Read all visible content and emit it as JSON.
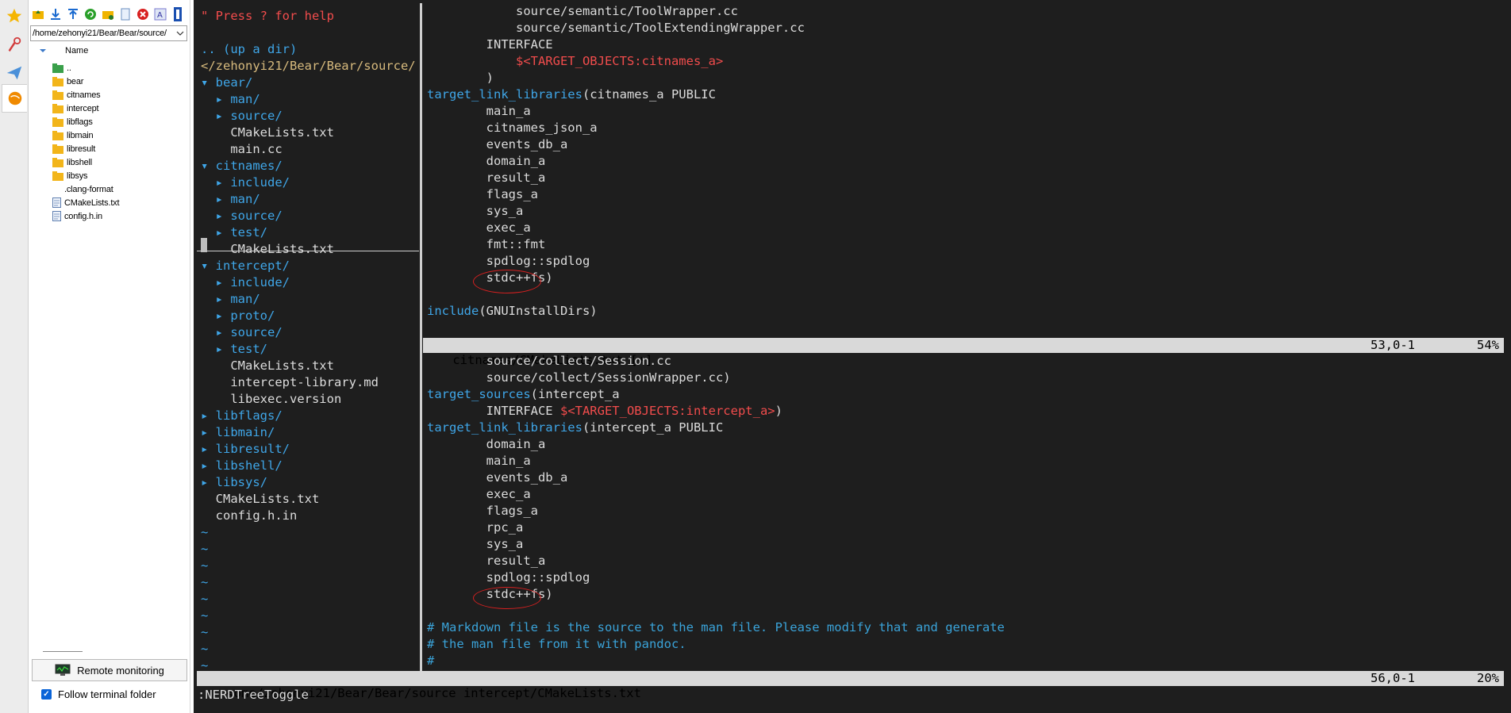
{
  "tab_strip": {
    "tabs": [
      {
        "name": "favorites-tab-icon",
        "color": "#f5b500"
      },
      {
        "name": "tools-tab-icon",
        "color": "#d23c3c"
      },
      {
        "name": "sftp-tab-icon",
        "color": "#4a90d9"
      },
      {
        "name": "macros-tab-icon",
        "color": "#f08a00"
      }
    ]
  },
  "sftp": {
    "path": "/home/zehonyi21/Bear/Bear/source/",
    "column_name": "Name",
    "files": [
      {
        "name": "..",
        "kind": "parent"
      },
      {
        "name": "bear",
        "kind": "folder"
      },
      {
        "name": "citnames",
        "kind": "folder"
      },
      {
        "name": "intercept",
        "kind": "folder"
      },
      {
        "name": "libflags",
        "kind": "folder"
      },
      {
        "name": "libmain",
        "kind": "folder"
      },
      {
        "name": "libresult",
        "kind": "folder"
      },
      {
        "name": "libshell",
        "kind": "folder"
      },
      {
        "name": "libsys",
        "kind": "folder"
      },
      {
        "name": ".clang-format",
        "kind": "blank"
      },
      {
        "name": "CMakeLists.txt",
        "kind": "file"
      },
      {
        "name": "config.h.in",
        "kind": "file"
      }
    ],
    "remote_monitoring_label": "Remote monitoring",
    "follow_terminal_label": "Follow terminal folder",
    "follow_terminal_checked": true
  },
  "tree": {
    "lines": [
      {
        "text": "\" Press ? for help",
        "color": "red"
      },
      {
        "text": "",
        "color": "white"
      },
      {
        "text": ".. (up a dir)",
        "color": "blue"
      },
      {
        "text": "</zehonyi21/Bear/Bear/source/",
        "color": "yellow"
      },
      {
        "text": "▾ bear/",
        "color": "blue"
      },
      {
        "text": "  ▸ man/",
        "color": "blue"
      },
      {
        "text": "  ▸ source/",
        "color": "blue"
      },
      {
        "text": "    CMakeLists.txt",
        "color": "white"
      },
      {
        "text": "    main.cc",
        "color": "white"
      },
      {
        "text": "▾ citnames/",
        "color": "blue"
      },
      {
        "text": "  ▸ include/",
        "color": "blue"
      },
      {
        "text": "  ▸ man/",
        "color": "blue"
      },
      {
        "text": "  ▸ source/",
        "color": "blue"
      },
      {
        "text": "  ▸ test/",
        "color": "blue"
      },
      {
        "text": "    CMakeLists.txt",
        "color": "white"
      },
      {
        "text": "▾ intercept/",
        "color": "blue"
      },
      {
        "text": "  ▸ include/",
        "color": "blue"
      },
      {
        "text": "  ▸ man/",
        "color": "blue"
      },
      {
        "text": "  ▸ proto/",
        "color": "blue"
      },
      {
        "text": "  ▸ source/",
        "color": "blue"
      },
      {
        "text": "  ▸ test/",
        "color": "blue"
      },
      {
        "text": "    CMakeLists.txt",
        "color": "white"
      },
      {
        "text": "    intercept-library.md",
        "color": "white"
      },
      {
        "text": "    libexec.version",
        "color": "white"
      },
      {
        "text": "▸ libflags/",
        "color": "blue"
      },
      {
        "text": "▸ libmain/",
        "color": "blue"
      },
      {
        "text": "▸ libresult/",
        "color": "blue"
      },
      {
        "text": "▸ libshell/",
        "color": "blue"
      },
      {
        "text": "▸ libsys/",
        "color": "blue"
      },
      {
        "text": "  CMakeLists.txt",
        "color": "white"
      },
      {
        "text": "  config.h.in",
        "color": "white"
      },
      {
        "text": "~",
        "color": "blue"
      },
      {
        "text": "~",
        "color": "blue"
      },
      {
        "text": "~",
        "color": "blue"
      },
      {
        "text": "~",
        "color": "blue"
      },
      {
        "text": "~",
        "color": "blue"
      },
      {
        "text": "~",
        "color": "blue"
      },
      {
        "text": "~",
        "color": "blue"
      },
      {
        "text": "~",
        "color": "blue"
      },
      {
        "text": "~",
        "color": "blue"
      }
    ]
  },
  "editor_top": {
    "lines": [
      [
        {
          "t": "            source/semantic/ToolWrapper.cc",
          "c": "white"
        }
      ],
      [
        {
          "t": "            source/semantic/ToolExtendingWrapper.cc",
          "c": "white"
        }
      ],
      [
        {
          "t": "        INTERFACE",
          "c": "white"
        }
      ],
      [
        {
          "t": "            ",
          "c": "white"
        },
        {
          "t": "$<TARGET_OBJECTS:citnames_a>",
          "c": "red"
        }
      ],
      [
        {
          "t": "        )",
          "c": "white"
        }
      ],
      [
        {
          "t": "target_link_libraries",
          "c": "blue"
        },
        {
          "t": "(citnames_a PUBLIC",
          "c": "white"
        }
      ],
      [
        {
          "t": "        main_a",
          "c": "white"
        }
      ],
      [
        {
          "t": "        citnames_json_a",
          "c": "white"
        }
      ],
      [
        {
          "t": "        events_db_a",
          "c": "white"
        }
      ],
      [
        {
          "t": "        domain_a",
          "c": "white"
        }
      ],
      [
        {
          "t": "        result_a",
          "c": "white"
        }
      ],
      [
        {
          "t": "        flags_a",
          "c": "white"
        }
      ],
      [
        {
          "t": "        sys_a",
          "c": "white"
        }
      ],
      [
        {
          "t": "        exec_a",
          "c": "white"
        }
      ],
      [
        {
          "t": "        fmt::fmt",
          "c": "white"
        }
      ],
      [
        {
          "t": "        spdlog::spdlog",
          "c": "white"
        }
      ],
      [
        {
          "t": "        stdc++fs)",
          "c": "white"
        }
      ],
      [
        {
          "t": "",
          "c": "white"
        }
      ],
      [
        {
          "t": "include",
          "c": "blue"
        },
        {
          "t": "(GNUInstallDirs)",
          "c": "white"
        }
      ]
    ],
    "status_file": "citnames/CMakeLists.txt [+]",
    "status_pos": "53,0-1",
    "status_pct": "54%"
  },
  "editor_bottom": {
    "lines": [
      [
        {
          "t": "        source/collect/Session.cc",
          "c": "white"
        }
      ],
      [
        {
          "t": "        source/collect/SessionWrapper.cc)",
          "c": "white"
        }
      ],
      [
        {
          "t": "target_sources",
          "c": "blue"
        },
        {
          "t": "(intercept_a",
          "c": "white"
        }
      ],
      [
        {
          "t": "        INTERFACE ",
          "c": "white"
        },
        {
          "t": "$<TARGET_OBJECTS:intercept_a>",
          "c": "red"
        },
        {
          "t": ")",
          "c": "white"
        }
      ],
      [
        {
          "t": "target_link_libraries",
          "c": "blue"
        },
        {
          "t": "(intercept_a PUBLIC",
          "c": "white"
        }
      ],
      [
        {
          "t": "        domain_a",
          "c": "white"
        }
      ],
      [
        {
          "t": "        main_a",
          "c": "white"
        }
      ],
      [
        {
          "t": "        events_db_a",
          "c": "white"
        }
      ],
      [
        {
          "t": "        exec_a",
          "c": "white"
        }
      ],
      [
        {
          "t": "        flags_a",
          "c": "white"
        }
      ],
      [
        {
          "t": "        rpc_a",
          "c": "white"
        }
      ],
      [
        {
          "t": "        sys_a",
          "c": "white"
        }
      ],
      [
        {
          "t": "        result_a",
          "c": "white"
        }
      ],
      [
        {
          "t": "        spdlog::spdlog",
          "c": "white"
        }
      ],
      [
        {
          "t": "        stdc++fs)",
          "c": "white"
        }
      ],
      [
        {
          "t": "",
          "c": "white"
        }
      ],
      [
        {
          "t": "# Markdown file is the source to the man file. Please modify that and generate",
          "c": "comment"
        }
      ],
      [
        {
          "t": "# the man file from it with pandoc.",
          "c": "comment"
        }
      ],
      [
        {
          "t": "#",
          "c": "comment"
        }
      ]
    ],
    "status_file": "<ome/zehonyi21/Bear/Bear/source intercept/CMakeLists.txt",
    "status_pos": "56,0-1",
    "status_pct": "20%"
  },
  "command_line": ":NERDTreeToggle",
  "colors": {
    "terminal_bg": "#1e1e1e",
    "keyword_blue": "#3fa6e8",
    "string_red": "#f14c4c",
    "dir_yellow": "#d7ba7d",
    "annotation_red": "#d42020"
  }
}
